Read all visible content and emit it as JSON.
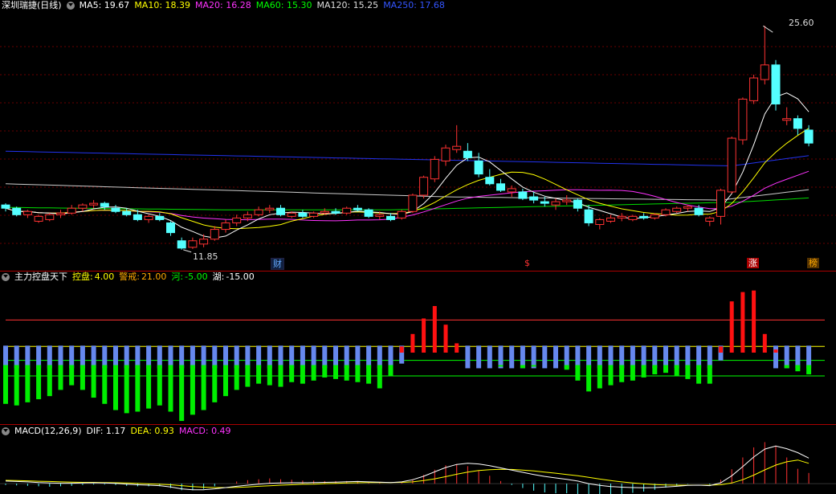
{
  "main": {
    "title": "深圳瑞捷(日线)",
    "indicators": [
      {
        "label": "MA5: 19.67",
        "color": "#ffffff"
      },
      {
        "label": "MA10: 18.39",
        "color": "#ffff00"
      },
      {
        "label": "MA20: 16.28",
        "color": "#ff33ff"
      },
      {
        "label": "MA60: 15.30",
        "color": "#00ff00"
      },
      {
        "label": "MA120: 15.25",
        "color": "#dddddd"
      },
      {
        "label": "MA250: 17.68",
        "color": "#3355ff"
      }
    ],
    "high_label": "25.60",
    "low_label": "11.85",
    "markers": [
      {
        "text": "财",
        "color": "#66aaff"
      },
      {
        "text": "$",
        "color": "#ff3333"
      },
      {
        "text": "涨",
        "color": "#ffffff"
      },
      {
        "text": "榜",
        "color": "#ffaa00"
      }
    ]
  },
  "panel2": {
    "title": "主力控盘天下",
    "items": [
      {
        "label": "控盘:",
        "value": "4.00",
        "color": "#ffff00"
      },
      {
        "label": "警戒:",
        "value": "21.00",
        "color": "#ffaa00"
      },
      {
        "label": "河:",
        "value": "-5.00",
        "color": "#00ff00"
      },
      {
        "label": "湖:",
        "value": "-15.00",
        "color": "#ffffff"
      }
    ]
  },
  "panel3": {
    "title": "MACD(12,26,9)",
    "items": [
      {
        "label": "DIF: 1.17",
        "color": "#ffffff"
      },
      {
        "label": "DEA: 0.93",
        "color": "#ffff00"
      },
      {
        "label": "MACD: 0.49",
        "color": "#ff33ff"
      }
    ]
  },
  "chart_data": [
    {
      "type": "candlestick",
      "ohlc": [
        [
          14.6,
          14.7,
          14.2,
          14.4
        ],
        [
          14.4,
          14.5,
          13.9,
          14.0
        ],
        [
          14.0,
          14.3,
          13.8,
          14.2
        ],
        [
          13.6,
          14.0,
          13.5,
          13.9
        ],
        [
          13.7,
          14.1,
          13.6,
          14.0
        ],
        [
          14.0,
          14.3,
          13.8,
          14.1
        ],
        [
          14.1,
          14.6,
          14.0,
          14.4
        ],
        [
          14.4,
          14.7,
          14.2,
          14.6
        ],
        [
          14.6,
          14.9,
          14.4,
          14.7
        ],
        [
          14.7,
          14.8,
          14.3,
          14.5
        ],
        [
          14.4,
          14.6,
          14.1,
          14.2
        ],
        [
          14.2,
          14.4,
          13.9,
          14.0
        ],
        [
          14.0,
          14.3,
          13.6,
          13.7
        ],
        [
          13.7,
          14.0,
          13.5,
          13.9
        ],
        [
          13.9,
          14.1,
          13.6,
          13.7
        ],
        [
          13.5,
          13.6,
          12.7,
          12.9
        ],
        [
          12.4,
          12.6,
          11.85,
          11.95
        ],
        [
          12.0,
          12.6,
          11.9,
          12.4
        ],
        [
          12.2,
          12.8,
          12.0,
          12.5
        ],
        [
          12.5,
          13.3,
          12.4,
          13.1
        ],
        [
          13.1,
          13.7,
          12.9,
          13.5
        ],
        [
          13.5,
          14.0,
          13.3,
          13.8
        ],
        [
          13.8,
          14.2,
          13.6,
          14.0
        ],
        [
          14.0,
          14.5,
          13.9,
          14.3
        ],
        [
          14.3,
          14.6,
          14.1,
          14.4
        ],
        [
          14.4,
          14.6,
          13.9,
          14.0
        ],
        [
          13.9,
          14.2,
          13.8,
          14.1
        ],
        [
          14.1,
          14.3,
          13.8,
          13.9
        ],
        [
          13.9,
          14.2,
          13.8,
          14.1
        ],
        [
          14.1,
          14.4,
          14.0,
          14.2
        ],
        [
          14.2,
          14.4,
          14.0,
          14.1
        ],
        [
          14.1,
          14.5,
          14.0,
          14.4
        ],
        [
          14.4,
          14.6,
          14.2,
          14.3
        ],
        [
          14.3,
          14.4,
          13.8,
          13.9
        ],
        [
          13.9,
          14.2,
          13.7,
          14.0
        ],
        [
          13.9,
          14.1,
          13.6,
          13.7
        ],
        [
          13.8,
          14.3,
          13.7,
          14.2
        ],
        [
          14.2,
          15.3,
          14.1,
          15.2
        ],
        [
          15.2,
          16.4,
          15.0,
          16.3
        ],
        [
          16.2,
          17.6,
          16.0,
          17.4
        ],
        [
          17.3,
          18.3,
          17.0,
          18.1
        ],
        [
          18.0,
          19.5,
          17.8,
          18.2
        ],
        [
          17.9,
          18.4,
          17.3,
          17.5
        ],
        [
          17.3,
          17.8,
          16.3,
          16.5
        ],
        [
          16.3,
          16.8,
          15.8,
          15.9
        ],
        [
          15.9,
          16.2,
          15.4,
          15.5
        ],
        [
          15.4,
          15.8,
          15.1,
          15.6
        ],
        [
          15.4,
          15.6,
          14.9,
          15.0
        ],
        [
          15.1,
          15.4,
          14.7,
          14.9
        ],
        [
          14.8,
          15.1,
          14.5,
          14.7
        ],
        [
          14.6,
          15.0,
          14.3,
          14.8
        ],
        [
          14.8,
          15.2,
          14.6,
          14.9
        ],
        [
          14.9,
          15.0,
          14.2,
          14.4
        ],
        [
          14.3,
          14.6,
          13.3,
          13.5
        ],
        [
          13.4,
          13.8,
          13.1,
          13.7
        ],
        [
          13.6,
          14.0,
          13.5,
          13.8
        ],
        [
          13.8,
          14.1,
          13.6,
          13.9
        ],
        [
          13.7,
          14.0,
          13.6,
          13.9
        ],
        [
          13.9,
          14.1,
          13.7,
          13.8
        ],
        [
          13.8,
          14.1,
          13.7,
          14.0
        ],
        [
          14.0,
          14.4,
          13.9,
          14.3
        ],
        [
          14.2,
          14.5,
          14.1,
          14.4
        ],
        [
          14.4,
          14.6,
          14.2,
          14.5
        ],
        [
          14.4,
          14.6,
          13.9,
          14.0
        ],
        [
          13.6,
          13.9,
          13.3,
          13.8
        ],
        [
          13.9,
          15.6,
          13.4,
          15.5
        ],
        [
          15.4,
          18.8,
          15.3,
          18.7
        ],
        [
          18.6,
          21.2,
          18.3,
          21.1
        ],
        [
          21.0,
          22.6,
          20.8,
          22.4
        ],
        [
          22.3,
          25.6,
          22.0,
          23.2
        ],
        [
          23.2,
          23.5,
          20.4,
          20.8
        ],
        [
          19.8,
          20.6,
          19.5,
          19.9
        ],
        [
          19.9,
          20.1,
          18.9,
          19.3
        ],
        [
          19.2,
          19.5,
          18.2,
          18.4
        ]
      ],
      "ma_lines": [
        "MA5",
        "MA10",
        "MA20",
        "MA60",
        "MA120",
        "MA250"
      ],
      "high": 25.6,
      "low": 11.85
    },
    {
      "type": "bar",
      "reference_levels": [
        21.0,
        4.0,
        -5.0,
        -15.0
      ],
      "pos_values": [
        0,
        0,
        0,
        0,
        0,
        0,
        0,
        0,
        0,
        0,
        0,
        0,
        0,
        0,
        0,
        0,
        0,
        0,
        0,
        0,
        0,
        0,
        0,
        0,
        0,
        0,
        0,
        0,
        0,
        0,
        0,
        0,
        0,
        0,
        0,
        0,
        4,
        12,
        22,
        30,
        18,
        6,
        0,
        0,
        0,
        0,
        0,
        0,
        0,
        0,
        0,
        0,
        0,
        0,
        0,
        0,
        0,
        0,
        0,
        0,
        0,
        0,
        0,
        0,
        0,
        4,
        33,
        39,
        40,
        12,
        2,
        0,
        0,
        0
      ],
      "base_values": [
        -8,
        -8,
        -8,
        -8,
        -8,
        -8,
        -8,
        -8,
        -8,
        -8,
        -8,
        -8,
        -8,
        -8,
        -8,
        -8,
        -8,
        -8,
        -8,
        -8,
        -8,
        -8,
        -8,
        -8,
        -8,
        -8,
        -8,
        -8,
        -8,
        -8,
        -8,
        -8,
        -8,
        -8,
        -8,
        -8,
        -5,
        0,
        0,
        0,
        0,
        0,
        -8,
        -8,
        -8,
        -8,
        -8,
        -8,
        -8,
        -8,
        -8,
        -8,
        -8,
        -8,
        -8,
        -8,
        -8,
        -8,
        -8,
        -8,
        -8,
        -8,
        -8,
        -8,
        -8,
        -3,
        0,
        0,
        0,
        0,
        -8,
        -8,
        -8,
        -8
      ],
      "neg_values": [
        -33,
        -34,
        -32,
        -30,
        -28,
        -24,
        -21,
        -24,
        -29,
        -33,
        -37,
        -39,
        -38,
        -36,
        -34,
        -38,
        -44,
        -40,
        -37,
        -32,
        -28,
        -24,
        -22,
        -20,
        -21,
        -22,
        -19,
        -20,
        -18,
        -16,
        -17,
        -18,
        -19,
        -20,
        -23,
        -15,
        -4,
        0,
        0,
        0,
        0,
        0,
        -3,
        -5,
        -7,
        -9,
        -8,
        -10,
        -9,
        -7,
        -8,
        -11,
        -18,
        -25,
        -23,
        -21,
        -19,
        -18,
        -16,
        -14,
        -13,
        -15,
        -17,
        -20,
        -20,
        -3,
        0,
        0,
        0,
        0,
        -8,
        -10,
        -12,
        -14
      ]
    },
    {
      "type": "line",
      "dif": [
        0.12,
        0.1,
        0.08,
        0.05,
        0.03,
        0.02,
        0.02,
        0.03,
        0.04,
        0.03,
        0.01,
        -0.02,
        -0.05,
        -0.07,
        -0.09,
        -0.15,
        -0.24,
        -0.28,
        -0.28,
        -0.24,
        -0.18,
        -0.12,
        -0.07,
        -0.02,
        0.02,
        0.03,
        0.04,
        0.04,
        0.05,
        0.06,
        0.07,
        0.09,
        0.1,
        0.08,
        0.07,
        0.05,
        0.08,
        0.18,
        0.34,
        0.54,
        0.74,
        0.88,
        0.93,
        0.9,
        0.82,
        0.72,
        0.62,
        0.52,
        0.42,
        0.33,
        0.26,
        0.2,
        0.12,
        0.0,
        -0.08,
        -0.13,
        -0.16,
        -0.18,
        -0.19,
        -0.18,
        -0.15,
        -0.12,
        -0.08,
        -0.07,
        -0.09,
        0.04,
        0.36,
        0.78,
        1.22,
        1.58,
        1.72,
        1.6,
        1.42,
        1.17
      ],
      "dea": [
        0.15,
        0.14,
        0.13,
        0.11,
        0.1,
        0.08,
        0.07,
        0.06,
        0.06,
        0.05,
        0.04,
        0.03,
        0.01,
        -0.01,
        -0.03,
        -0.05,
        -0.09,
        -0.13,
        -0.16,
        -0.18,
        -0.18,
        -0.17,
        -0.15,
        -0.12,
        -0.1,
        -0.07,
        -0.05,
        -0.03,
        -0.02,
        0.0,
        0.01,
        0.03,
        0.04,
        0.05,
        0.05,
        0.05,
        0.06,
        0.08,
        0.14,
        0.22,
        0.32,
        0.43,
        0.53,
        0.6,
        0.64,
        0.66,
        0.65,
        0.62,
        0.58,
        0.53,
        0.48,
        0.42,
        0.36,
        0.29,
        0.21,
        0.14,
        0.08,
        0.03,
        -0.01,
        -0.04,
        -0.06,
        -0.07,
        -0.07,
        -0.07,
        -0.07,
        -0.05,
        0.03,
        0.18,
        0.39,
        0.63,
        0.85,
        1.0,
        1.08,
        0.93
      ],
      "macd": [
        -0.06,
        -0.08,
        -0.1,
        -0.12,
        -0.14,
        -0.12,
        -0.1,
        -0.06,
        -0.04,
        -0.04,
        -0.06,
        -0.1,
        -0.12,
        -0.12,
        -0.12,
        -0.2,
        -0.3,
        -0.3,
        -0.24,
        -0.12,
        0.0,
        0.1,
        0.16,
        0.2,
        0.24,
        0.2,
        0.18,
        0.14,
        0.14,
        0.12,
        0.12,
        0.12,
        0.12,
        0.06,
        0.04,
        0.0,
        0.04,
        0.2,
        0.4,
        0.64,
        0.84,
        0.9,
        0.8,
        0.6,
        0.36,
        0.12,
        -0.06,
        -0.2,
        -0.32,
        -0.4,
        -0.44,
        -0.44,
        -0.48,
        -0.58,
        -0.58,
        -0.54,
        -0.48,
        -0.42,
        -0.36,
        -0.28,
        -0.18,
        -0.1,
        -0.02,
        0.0,
        -0.04,
        0.18,
        0.66,
        1.2,
        1.66,
        1.9,
        1.74,
        1.2,
        0.68,
        0.49
      ]
    }
  ]
}
